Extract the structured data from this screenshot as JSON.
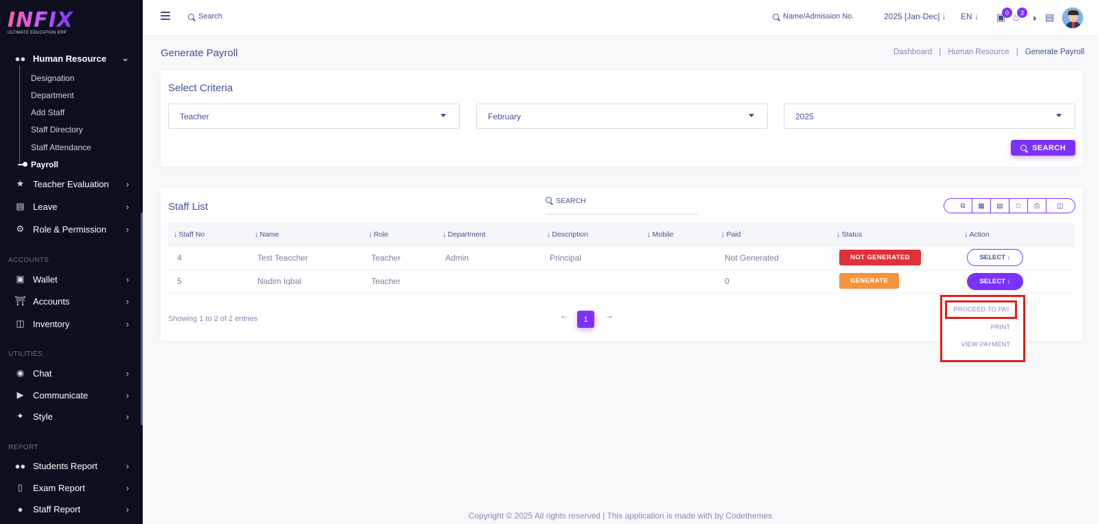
{
  "brand": {
    "logo_text": "INFIX",
    "tagline": "ULTIMATE EDUCATION ERP"
  },
  "sidebar": {
    "human_resource": "Human Resource",
    "sub_items": [
      "Designation",
      "Department",
      "Add Staff",
      "Staff Directory",
      "Staff Attendance",
      "Payroll"
    ],
    "items_top": [
      "Teacher Evaluation",
      "Leave",
      "Role & Permission"
    ],
    "section_accounts": "ACCOUNTS",
    "items_accounts": [
      "Wallet",
      "Accounts",
      "Inventory"
    ],
    "section_utilities": "UTILITIES",
    "items_utilities": [
      "Chat",
      "Communicate",
      "Style"
    ],
    "section_report": "REPORT",
    "items_report": [
      "Students Report",
      "Exam Report",
      "Staff Report"
    ]
  },
  "header": {
    "search_placeholder": "Search",
    "admission_search": "Name/Admission No.",
    "academic_year": "2025 [Jan-Dec]",
    "language": "EN",
    "chat_count": "0",
    "notification_count": "3"
  },
  "page": {
    "title": "Generate Payroll",
    "breadcrumb": [
      "Dashboard",
      "Human Resource",
      "Generate Payroll"
    ]
  },
  "criteria": {
    "title": "Select Criteria",
    "role": "Teacher",
    "month": "February",
    "year": "2025",
    "search_button": "SEARCH"
  },
  "staff_list": {
    "title": "Staff List",
    "search_placeholder": "SEARCH",
    "columns": [
      "Staff No",
      "Name",
      "Role",
      "Department",
      "Description",
      "Mobile",
      "Paid",
      "Status",
      "Action"
    ],
    "rows": [
      {
        "staff_no": "4",
        "name": "Test Teaccher",
        "role": "Teacher",
        "department": "Admin",
        "description": "Principal",
        "mobile": "",
        "paid": "Not Generated",
        "status": "NOT GENERATED",
        "action": "SELECT"
      },
      {
        "staff_no": "5",
        "name": "Nadim Iqbal",
        "role": "Teacher",
        "department": "",
        "description": "",
        "mobile": "",
        "paid": "0",
        "status": "GENERATE",
        "action": "SELECT"
      }
    ],
    "showing": "Showing 1 to 2 of 2 entries",
    "current_page": "1",
    "dropdown": [
      "PROCEED TO PAY",
      "PRINT",
      "VIEW PAYMENT"
    ]
  },
  "footer": {
    "text": "Copyright © 2025 All rights reserved | This application is made with by Codethemes"
  },
  "colors": {
    "accent": "#7c32ff",
    "danger": "#e0303a",
    "warning": "#f7933a",
    "sidebar_bg": "#0d0f1e",
    "highlight": "#e11c1c"
  }
}
